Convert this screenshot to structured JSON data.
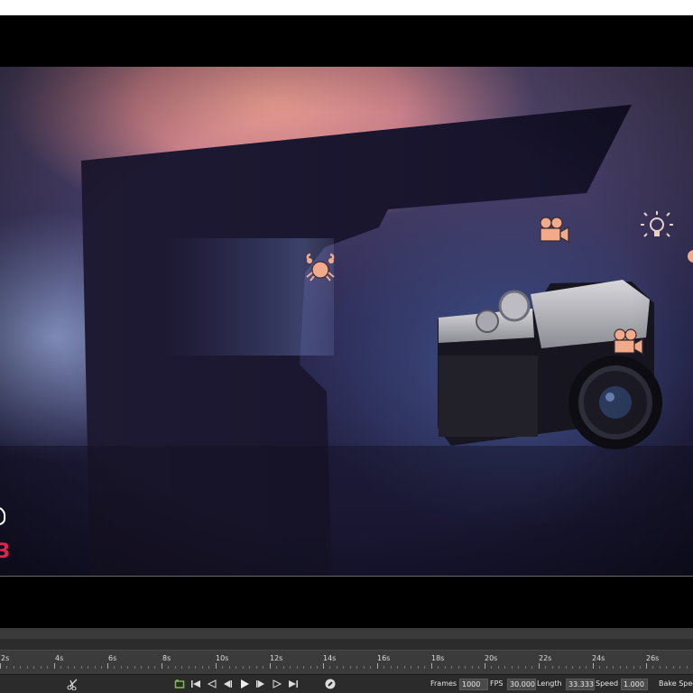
{
  "colors": {
    "gizmo": "#f2ab8a",
    "counter": "#e0234e",
    "panel_bg": "#2b2b2b",
    "ruler_bg": "#3b3b3b"
  },
  "viewport": {
    "frame_counter": "3",
    "overlay_icons": [
      "crab-icon",
      "movie-camera-icon",
      "light-bulb-icon",
      "movie-camera-icon"
    ]
  },
  "timeline": {
    "tick_labels": [
      "2s",
      "4s",
      "6s",
      "8s",
      "10s",
      "12s",
      "14s",
      "16s",
      "18s",
      "20s",
      "22s",
      "24s",
      "26s"
    ]
  },
  "controls": {
    "buttons": [
      "scissors-icon",
      "loop-icon",
      "go-start-icon",
      "prev-key-icon",
      "step-back-icon",
      "play-icon",
      "step-forward-icon",
      "next-key-icon",
      "go-end-icon",
      "compass-icon"
    ],
    "frames_label": "Frames",
    "frames_value": "1000",
    "fps_label": "FPS",
    "fps_value": "30.000",
    "length_label": "Length",
    "length_value": "33.333",
    "speed_label": "Speed",
    "speed_value": "1.000",
    "bake_label": "Bake Spee"
  }
}
